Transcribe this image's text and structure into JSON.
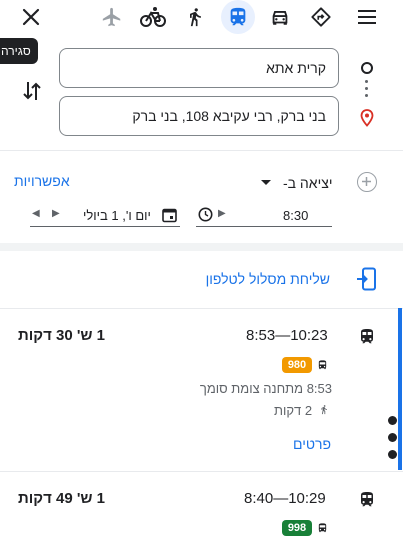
{
  "tooltip": "סגירה",
  "modes": [
    {
      "name": "flight",
      "active": false
    },
    {
      "name": "bicycle",
      "active": false
    },
    {
      "name": "walk",
      "active": false
    },
    {
      "name": "transit",
      "active": true
    },
    {
      "name": "car",
      "active": false
    },
    {
      "name": "best",
      "active": false
    }
  ],
  "origin": {
    "value": "קרית אתא"
  },
  "destination": {
    "value": "בני ברק, רבי עקיבא 108, בני ברק"
  },
  "options": {
    "label": "אפשרויות",
    "depart": "יציאה ב-",
    "date": "יום ו', 1 ביולי",
    "time": "8:30"
  },
  "send_to_phone": "שליחת מסלול לטלפון",
  "routes": [
    {
      "times": "8:53—10:23",
      "duration": "1 ש' 30 דקות",
      "line": "980",
      "line_color": "#f29900",
      "stop": "8:53 מתחנה צומת סומך",
      "walk": "2 דקות",
      "details": "פרטים"
    },
    {
      "times": "8:40—10:29",
      "duration": "1 ש' 49 דקות",
      "line": "998",
      "line_color": "#188038"
    }
  ],
  "colors": {
    "accent": "#1a73e8",
    "destination_pin": "#d93025"
  }
}
